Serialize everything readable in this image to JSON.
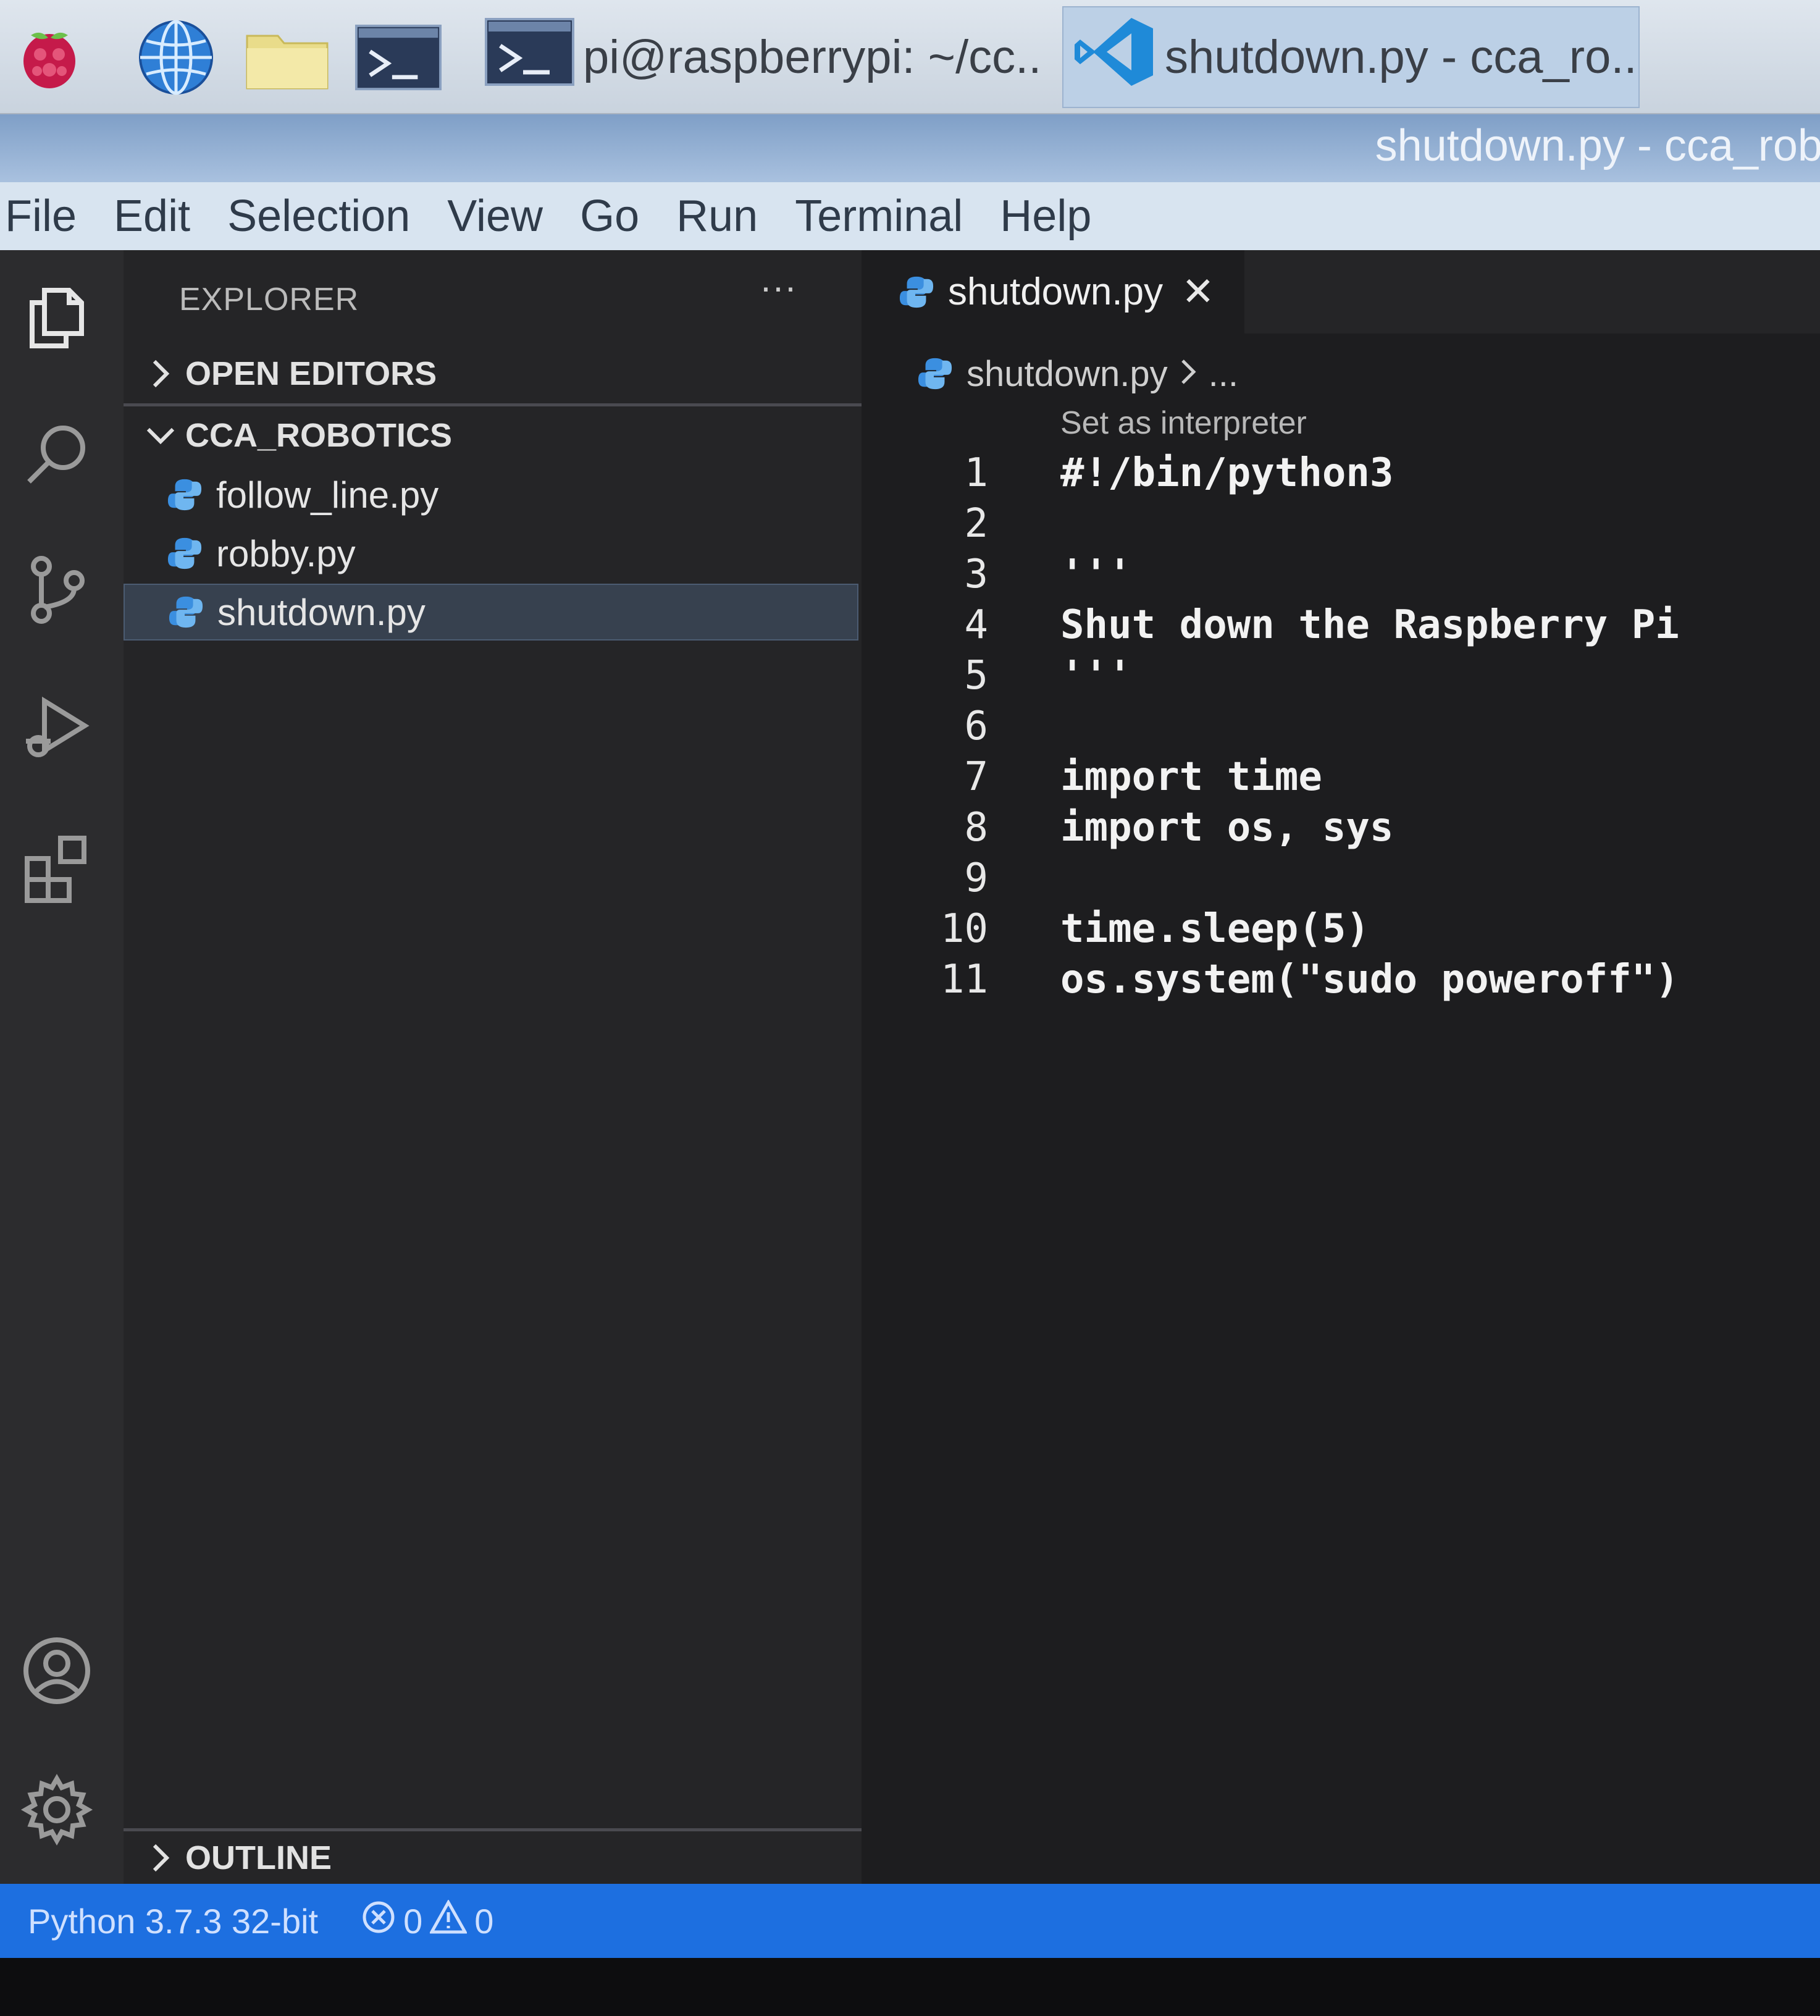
{
  "taskbar": {
    "tasks": [
      {
        "label": "pi@raspberrypi: ~/cc..."
      },
      {
        "label": "shutdown.py - cca_ro..."
      }
    ]
  },
  "window": {
    "title": "shutdown.py - cca_robc"
  },
  "menu": [
    "File",
    "Edit",
    "Selection",
    "View",
    "Go",
    "Run",
    "Terminal",
    "Help"
  ],
  "sidebar": {
    "header": "EXPLORER",
    "more": "···",
    "open_editors": "OPEN EDITORS",
    "folder": "CCA_ROBOTICS",
    "files": [
      "follow_line.py",
      "robby.py",
      "shutdown.py"
    ],
    "outline": "OUTLINE"
  },
  "editor": {
    "tab": "shutdown.py",
    "breadcrumb_file": "shutdown.py",
    "breadcrumb_rest": "...",
    "codelens": "Set as interpreter",
    "lines": [
      {
        "n": "1",
        "text": "#!/bin/python3"
      },
      {
        "n": "2",
        "text": ""
      },
      {
        "n": "3",
        "text": "'''"
      },
      {
        "n": "4",
        "text": "Shut down the Raspberry Pi"
      },
      {
        "n": "5",
        "text": "'''"
      },
      {
        "n": "6",
        "text": ""
      },
      {
        "n": "7",
        "text": "import time"
      },
      {
        "n": "8",
        "text": "import os, sys"
      },
      {
        "n": "9",
        "text": ""
      },
      {
        "n": "10",
        "text": "time.sleep(5)"
      },
      {
        "n": "11",
        "text": "os.system(\"sudo poweroff\")"
      }
    ]
  },
  "status": {
    "interpreter": "Python 3.7.3 32-bit",
    "errors": "0",
    "warnings": "0"
  },
  "colors": {
    "statusbar": "#1d6fe0",
    "python_icon": "#3b8fe0",
    "vscode_blue": "#1f8ad8"
  }
}
